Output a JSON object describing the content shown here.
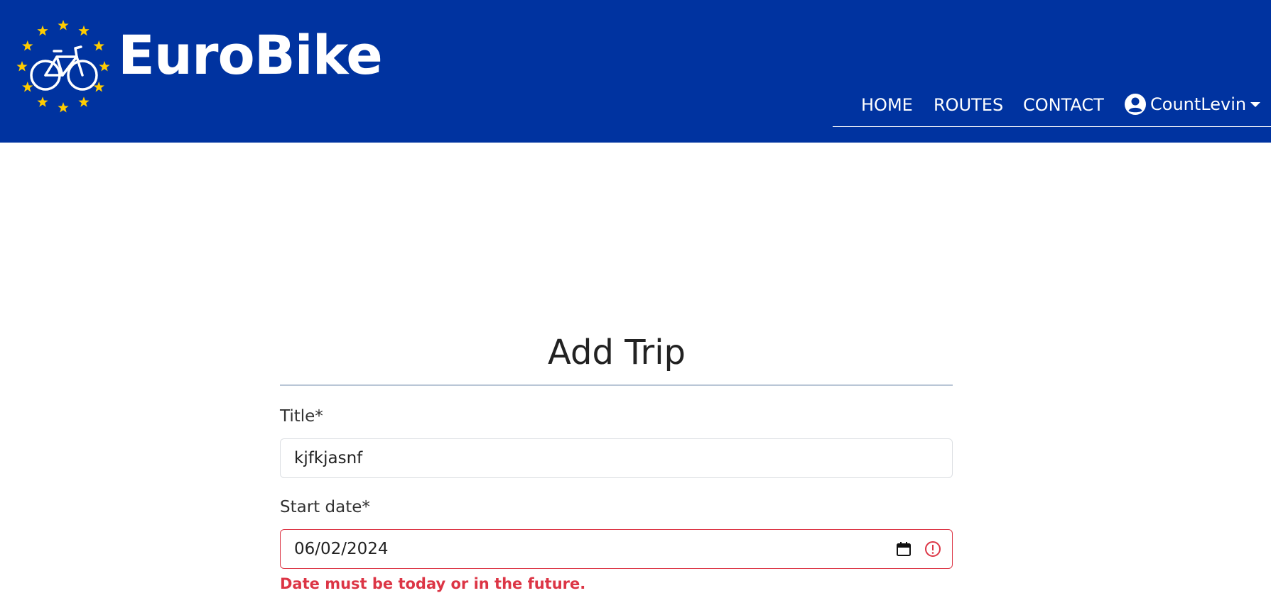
{
  "brand": {
    "name": "EuroBike"
  },
  "nav": {
    "items": [
      "HOME",
      "ROUTES",
      "CONTACT"
    ],
    "user": "CountLevin"
  },
  "page": {
    "title": "Add Trip"
  },
  "form": {
    "title_label": "Title*",
    "title_value": "kjfkjasnf",
    "start_label": "Start date*",
    "start_value": "06/02/2024",
    "start_error": "Date must be today or in the future."
  },
  "colors": {
    "header_bg": "#0033a0",
    "star": "#ffcc00",
    "error": "#dc3545"
  },
  "icons": {
    "logo": "eu-stars-bicycle-logo",
    "user": "user-circle-icon",
    "caret": "caret-down-icon",
    "calendar": "calendar-icon",
    "error": "exclamation-circle-icon"
  }
}
